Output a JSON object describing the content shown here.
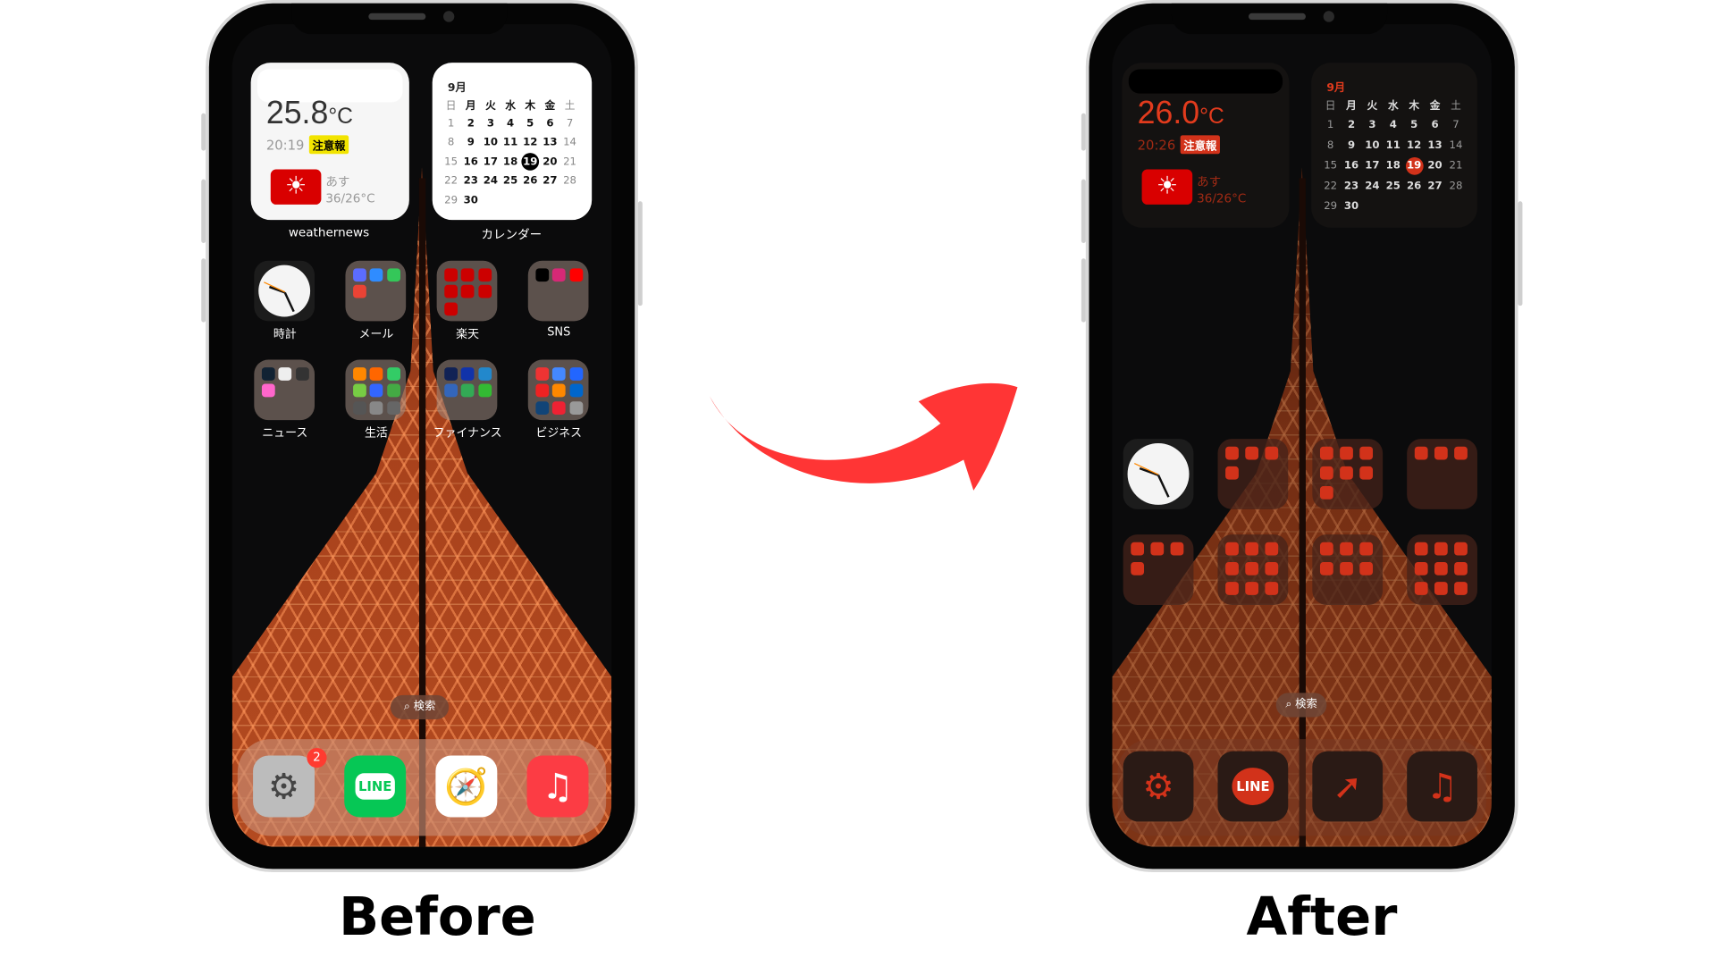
{
  "accent": "#ff3535",
  "captions": {
    "before": "Before",
    "after": "After"
  },
  "before": {
    "weather": {
      "temp": "25.8",
      "unit": "°C",
      "time": "20:19",
      "alert": "注意報",
      "tomorrow_label": "あす",
      "tomorrow_temp": "36/26°C",
      "icon": "sun-icon",
      "label": "weathernews"
    },
    "calendar": {
      "month": "9月",
      "label": "カレンダー",
      "today": 19
    },
    "icons": [
      {
        "label": "時計"
      },
      {
        "label": "メール"
      },
      {
        "label": "楽天"
      },
      {
        "label": "SNS"
      },
      {
        "label": "ニュース"
      },
      {
        "label": "生活"
      },
      {
        "label": "ファイナンス"
      },
      {
        "label": "ビジネス"
      }
    ],
    "search": "検索",
    "dock": [
      {
        "name": "settings",
        "badge": "2"
      },
      {
        "name": "line",
        "text": "LINE"
      },
      {
        "name": "safari"
      },
      {
        "name": "music"
      }
    ]
  },
  "after": {
    "weather": {
      "temp": "26.0",
      "unit": "°C",
      "time": "20:26",
      "alert": "注意報",
      "tomorrow_label": "あす",
      "tomorrow_temp": "36/26°C",
      "icon": "sun-icon"
    },
    "calendar": {
      "month": "9月",
      "today": 19
    },
    "search": "検索",
    "dock": [
      {
        "name": "settings"
      },
      {
        "name": "line",
        "text": "LINE"
      },
      {
        "name": "safari"
      },
      {
        "name": "music"
      }
    ]
  },
  "weekdays": [
    "日",
    "月",
    "火",
    "水",
    "木",
    "金",
    "土"
  ],
  "days": [
    1,
    2,
    3,
    4,
    5,
    6,
    7,
    8,
    9,
    10,
    11,
    12,
    13,
    14,
    15,
    16,
    17,
    18,
    19,
    20,
    21,
    22,
    23,
    24,
    25,
    26,
    27,
    28,
    29,
    30
  ]
}
